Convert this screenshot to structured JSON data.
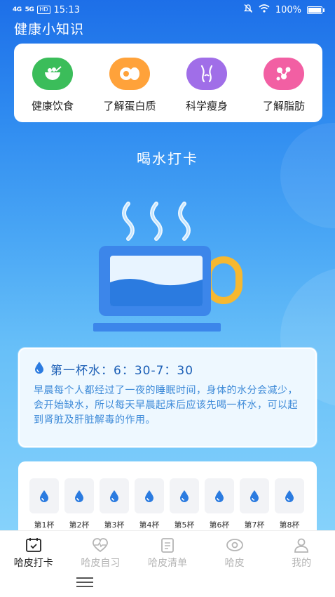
{
  "status_bar": {
    "signal1": "4G",
    "signal2": "5G",
    "hd": "HD",
    "time": "15:13",
    "battery": "100%"
  },
  "app": {
    "title": "健康小知识"
  },
  "categories": [
    {
      "label": "健康饮食",
      "icon": "bowl-icon",
      "color": "#3bbd5a"
    },
    {
      "label": "了解蛋白质",
      "icon": "egg-icon",
      "color": "#ffa23a"
    },
    {
      "label": "科学瘦身",
      "icon": "body-icon",
      "color": "#a06ee8"
    },
    {
      "label": "了解脂肪",
      "icon": "fat-molecule-icon",
      "color": "#f25fa3"
    }
  ],
  "section": {
    "title": "喝水打卡"
  },
  "info": {
    "heading": "第一杯水：6：30-7：30",
    "body": "早晨每个人都经过了一夜的睡眠时间，身体的水分会减少，会开始缺水，所以每天早晨起床后应该先喝一杯水，可以起到肾脏及肝脏解毒的作用。"
  },
  "cups": [
    "第1杯",
    "第2杯",
    "第3杯",
    "第4杯",
    "第5杯",
    "第6杯",
    "第7杯",
    "第8杯"
  ],
  "tabs": [
    {
      "label": "哈皮打卡",
      "icon": "calendar-check-icon",
      "active": true
    },
    {
      "label": "哈皮自习",
      "icon": "heartbeat-icon",
      "active": false
    },
    {
      "label": "哈皮清单",
      "icon": "clipboard-icon",
      "active": false
    },
    {
      "label": "哈皮",
      "icon": "eye-icon",
      "active": false
    },
    {
      "label": "我的",
      "icon": "user-icon",
      "active": false
    }
  ],
  "colors": {
    "primary": "#1d6fe8",
    "accent_water": "#2b7be0",
    "cup_handle": "#f6b830"
  }
}
